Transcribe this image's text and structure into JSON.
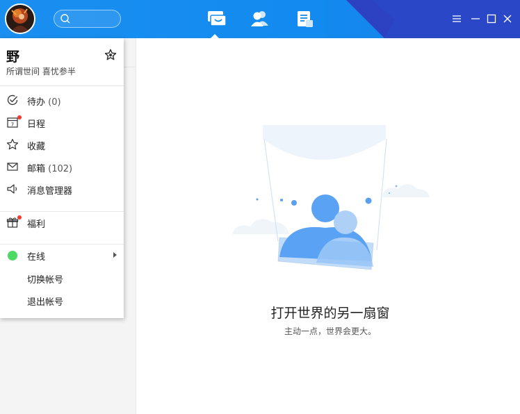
{
  "user": {
    "name": "野",
    "signature": "所谓世间 喜忧参半"
  },
  "menu": {
    "items": [
      {
        "label": "待办",
        "count": "(0)",
        "icon": "check-circle-icon"
      },
      {
        "label": "日程",
        "count": "",
        "icon": "calendar-icon",
        "calendar_day": "7"
      },
      {
        "label": "收藏",
        "count": "",
        "icon": "star-icon"
      },
      {
        "label": "邮箱",
        "count": "(102)",
        "icon": "mail-icon"
      },
      {
        "label": "消息管理器",
        "count": "",
        "icon": "speaker-icon"
      }
    ],
    "welfare": {
      "label": "福利",
      "icon": "gift-icon"
    },
    "status": {
      "label": "在线",
      "color": "#4cd964"
    },
    "switch_account": "切换帐号",
    "logout": "退出帐号"
  },
  "empty_state": {
    "title": "打开世界的另一扇窗",
    "subtitle": "主动一点，世界会更大。"
  },
  "colors": {
    "topbar": "#128aef",
    "accent_dark": "#2a47c8",
    "notification_dot": "#f23a2f",
    "online": "#4cd964"
  }
}
